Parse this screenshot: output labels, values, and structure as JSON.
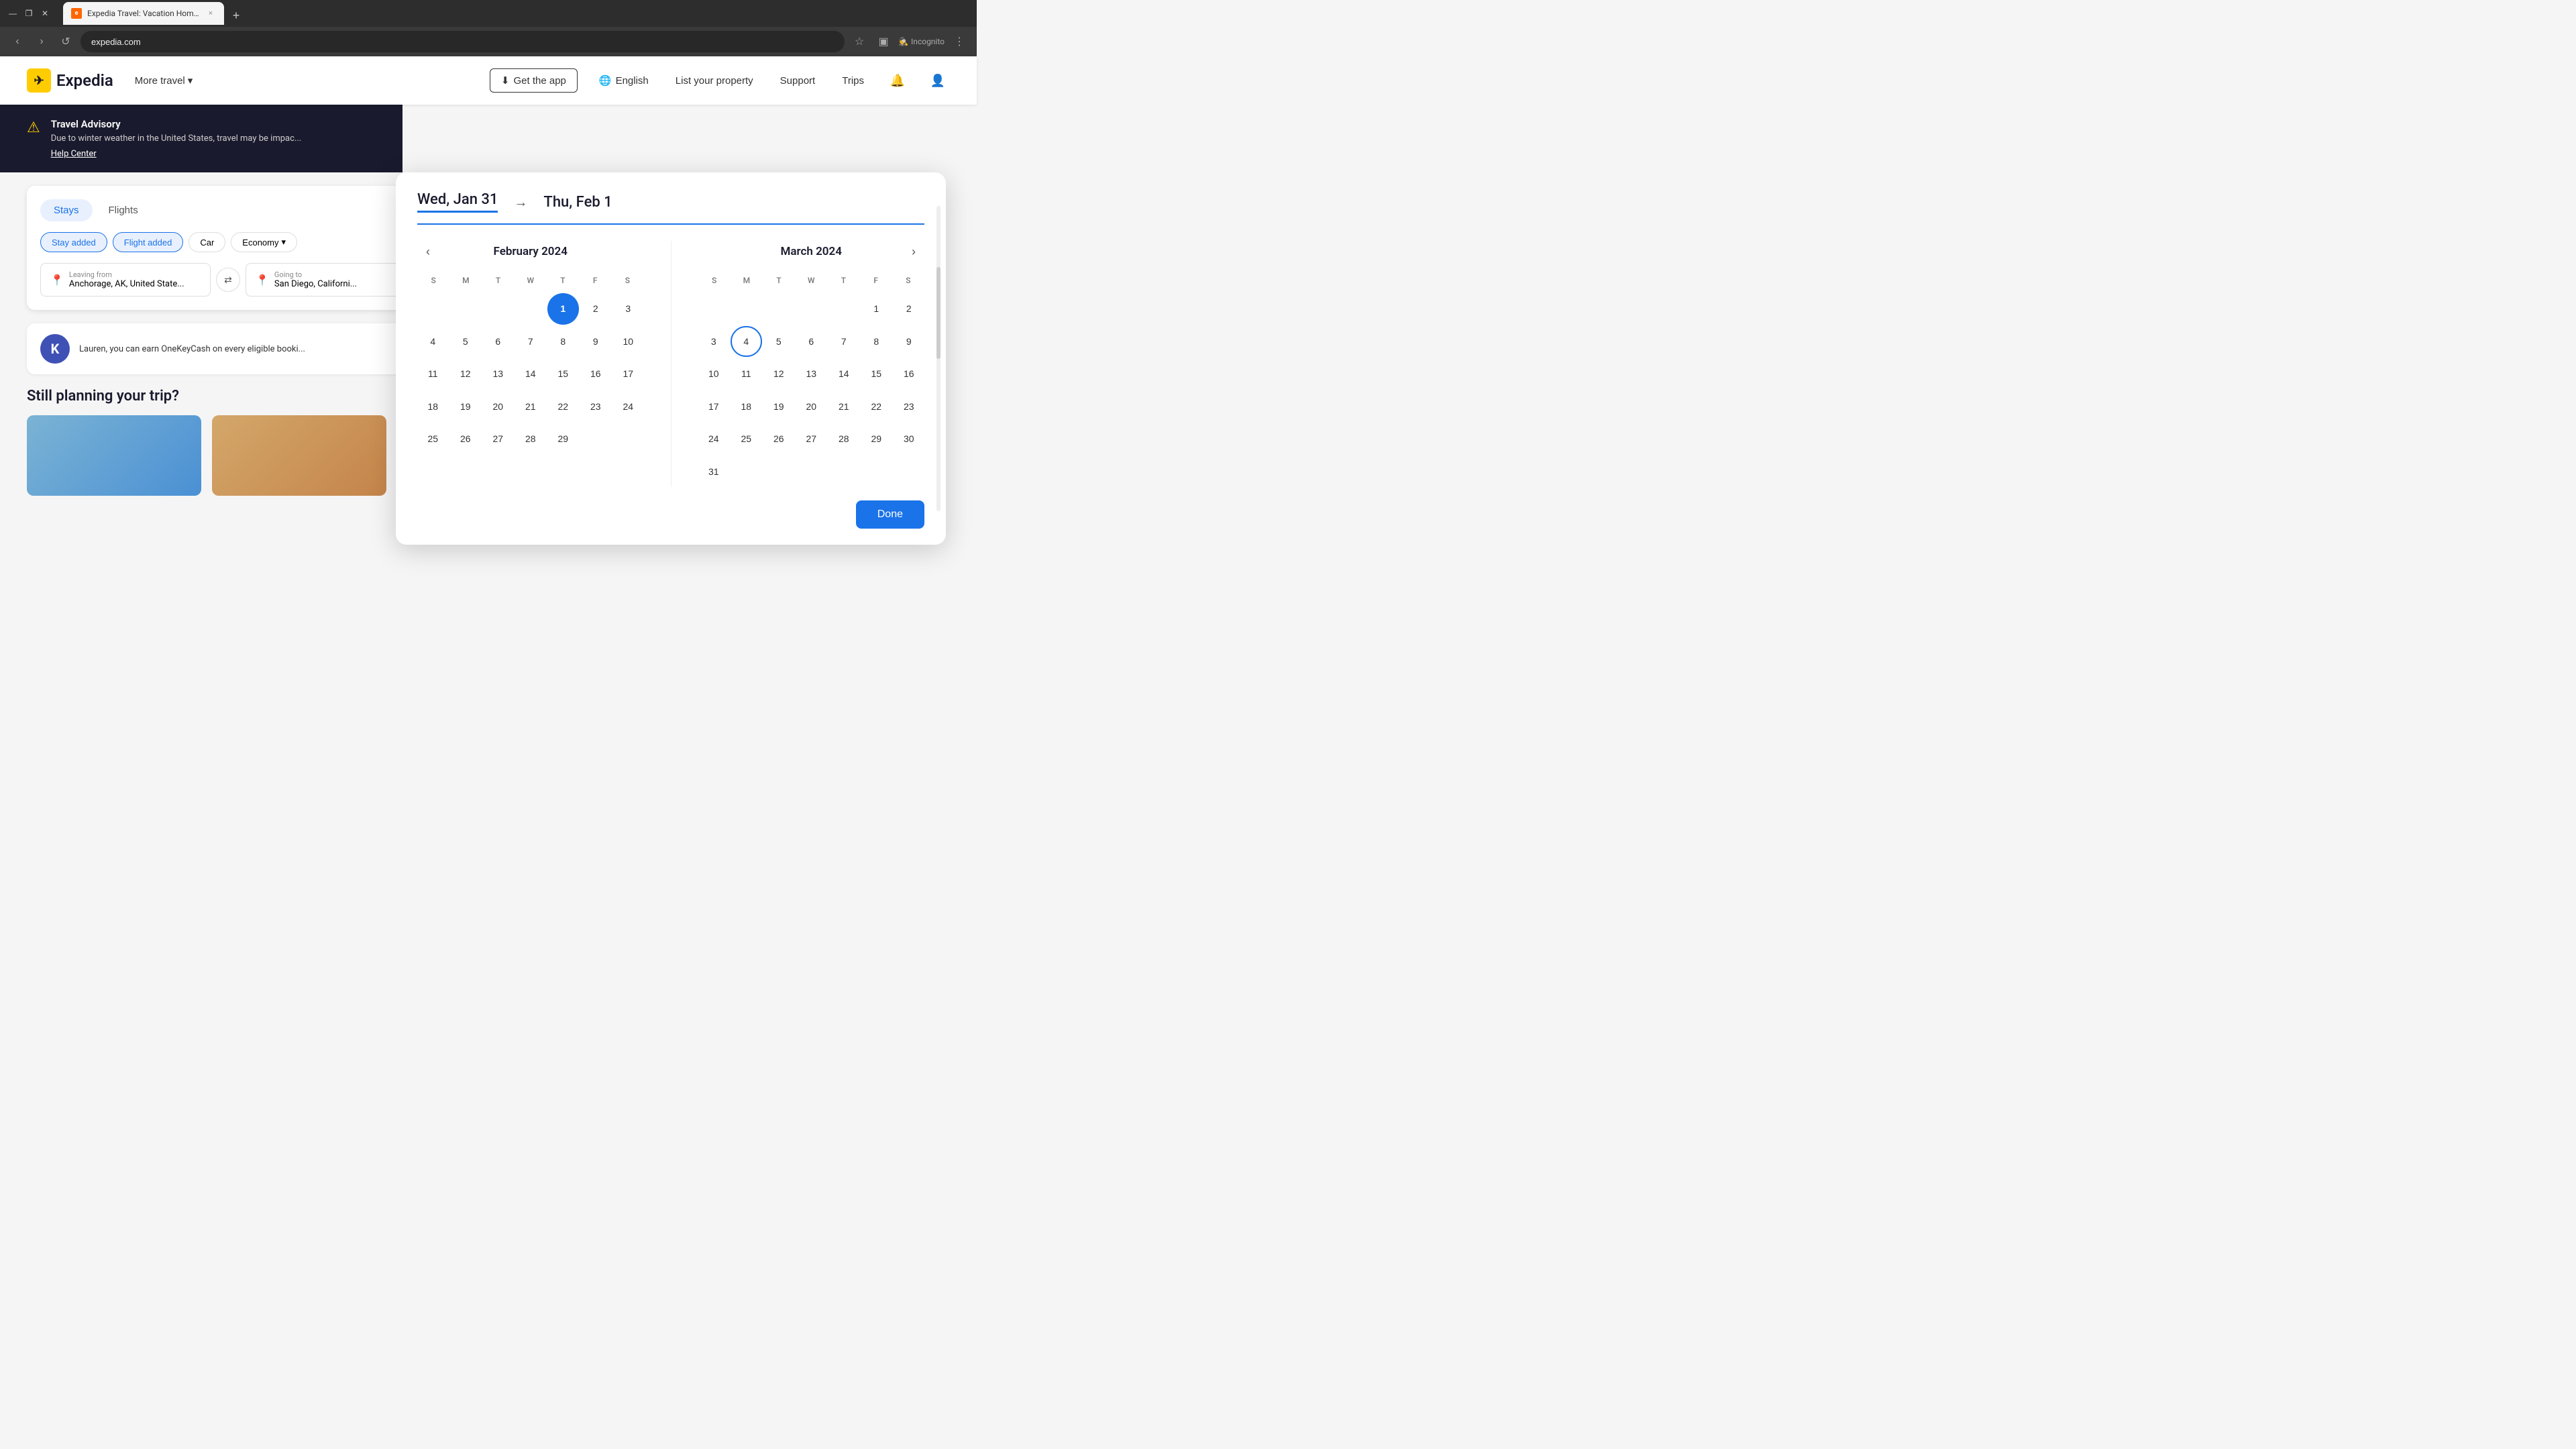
{
  "browser": {
    "tab_title": "Expedia Travel: Vacation Home...",
    "tab_close": "×",
    "tab_add": "+",
    "address": "expedia.com",
    "incognito_label": "Incognito",
    "nav_back": "‹",
    "nav_forward": "›",
    "nav_refresh": "↺",
    "win_minimize": "—",
    "win_restore": "❐",
    "win_close": "✕"
  },
  "header": {
    "logo_icon": "e",
    "logo_text": "Expedia",
    "more_travel": "More travel",
    "more_travel_chevron": "▾",
    "get_app": "Get the app",
    "language": "English",
    "list_property": "List your property",
    "support": "Support",
    "trips": "Trips"
  },
  "advisory": {
    "title": "Travel Advisory",
    "body": "Due to winter weather in the United States, travel may be impac...",
    "link": "Help Center"
  },
  "search": {
    "tabs": [
      "Stays",
      "Flights"
    ],
    "filters": [
      "Stay added",
      "Flight added",
      "Car",
      "Economy"
    ],
    "from_label": "Leaving from",
    "from_value": "Anchorage, AK, United State...",
    "to_label": "Going to",
    "to_value": "San Diego, Californi...",
    "swap_icon": "⇄"
  },
  "onekeycash": {
    "avatar": "K",
    "text": "Lauren, you can earn OneKeyCash on every eligible booki..."
  },
  "planning": {
    "title": "Still planning your trip?"
  },
  "calendar": {
    "check_in_label": "Wed, Jan 31",
    "check_out_label": "Thu, Feb 1",
    "arrow": "→",
    "feb": {
      "month_title": "February 2024",
      "weekdays": [
        "S",
        "M",
        "T",
        "W",
        "T",
        "F",
        "S"
      ],
      "weeks": [
        [
          "",
          "",
          "",
          "",
          "1",
          "2",
          "3"
        ],
        [
          "4",
          "5",
          "6",
          "7",
          "8",
          "9",
          "10"
        ],
        [
          "11",
          "12",
          "13",
          "14",
          "15",
          "16",
          "17"
        ],
        [
          "18",
          "19",
          "20",
          "21",
          "22",
          "23",
          "24"
        ],
        [
          "25",
          "26",
          "27",
          "28",
          "29",
          "",
          ""
        ]
      ],
      "selected_day": "1",
      "today_circle_day": ""
    },
    "mar": {
      "month_title": "March 2024",
      "weekdays": [
        "S",
        "M",
        "T",
        "W",
        "T",
        "F",
        "S"
      ],
      "weeks": [
        [
          "",
          "",
          "",
          "",
          "",
          "1",
          "2"
        ],
        [
          "3",
          "4",
          "5",
          "6",
          "7",
          "8",
          "9"
        ],
        [
          "10",
          "11",
          "12",
          "13",
          "14",
          "15",
          "16"
        ],
        [
          "17",
          "18",
          "19",
          "20",
          "21",
          "22",
          "23"
        ],
        [
          "24",
          "25",
          "26",
          "27",
          "28",
          "29",
          "30"
        ],
        [
          "31",
          "",
          "",
          "",
          "",
          "",
          ""
        ]
      ],
      "today_circle_day": "4"
    },
    "done_label": "Done"
  },
  "colors": {
    "primary": "#1a73e8",
    "selected_bg": "#1a73e8",
    "advisory_bg": "#1a1a2e",
    "logo_bg": "#ffcc00"
  }
}
